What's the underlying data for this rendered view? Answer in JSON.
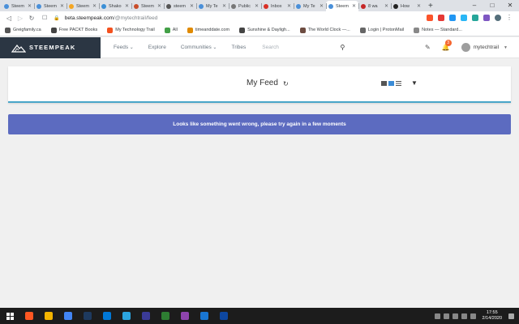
{
  "browser": {
    "tabs": [
      {
        "title": "Steem",
        "color": "#4a90d9",
        "active": false
      },
      {
        "title": "Steem",
        "color": "#4a90d9",
        "active": false
      },
      {
        "title": "Steem",
        "color": "#f4a622",
        "active": false
      },
      {
        "title": "Shako",
        "color": "#3b8fd6",
        "active": false
      },
      {
        "title": "Steem",
        "color": "#c94d2a",
        "active": false
      },
      {
        "title": "steem",
        "color": "#555555",
        "active": false
      },
      {
        "title": "My Te",
        "color": "#4a90d9",
        "active": false
      },
      {
        "title": "Public",
        "color": "#777777",
        "active": false
      },
      {
        "title": "Inbox",
        "color": "#d93025",
        "active": false
      },
      {
        "title": "My Te",
        "color": "#4a90d9",
        "active": false
      },
      {
        "title": "Steem",
        "color": "#4a90d9",
        "active": true
      },
      {
        "title": "8 wa",
        "color": "#c62828",
        "active": false
      },
      {
        "title": "How",
        "color": "#222222",
        "active": false
      }
    ],
    "new_tab": "+",
    "window_controls": {
      "minimize": "–",
      "maximize": "□",
      "close": "✕"
    },
    "address": {
      "host": "beta.steempeak.com",
      "path": "/@mytechtrail/feed"
    },
    "bookmarks": [
      {
        "label": "Greigfamily.ca",
        "color": "#555555"
      },
      {
        "label": "Free PACKT Books",
        "color": "#444444"
      },
      {
        "label": "My Technology Trail",
        "color": "#f4511e"
      },
      {
        "label": "All",
        "color": "#43a047"
      },
      {
        "label": "timeanddate.com",
        "color": "#e08a00"
      },
      {
        "label": "Sunshine & Dayligh...",
        "color": "#444444"
      },
      {
        "label": "The World Clock —...",
        "color": "#6d4c41"
      },
      {
        "label": "Login | ProtonMail",
        "color": "#666666"
      },
      {
        "label": "Notes — Standard...",
        "color": "#888888"
      }
    ]
  },
  "site": {
    "logo_text": "STEEMPEAK",
    "nav": [
      {
        "label": "Feeds",
        "has_caret": true
      },
      {
        "label": "Explore",
        "has_caret": false
      },
      {
        "label": "Communities",
        "has_caret": true
      },
      {
        "label": "Tribes",
        "has_caret": false
      }
    ],
    "search_placeholder": "Search",
    "notification_count": "3",
    "username": "mytechtrail"
  },
  "feed": {
    "title": "My Feed",
    "error_message": "Looks like something went wrong, please try again in a few moments"
  },
  "taskbar": {
    "time": "17:55",
    "date": "2/14/2020",
    "apps": [
      "#ff5722",
      "#f4b400",
      "#4285f4",
      "#1e3a5f",
      "#0078d7",
      "#2ca5e0",
      "#3b3b98",
      "#2e7d32",
      "#8e44ad",
      "#1976d2",
      "#0d47a1"
    ]
  },
  "colors": {
    "accent": "#4aa6c9",
    "error_bg": "#5c6bc0",
    "logo_bg": "#2b3643"
  }
}
